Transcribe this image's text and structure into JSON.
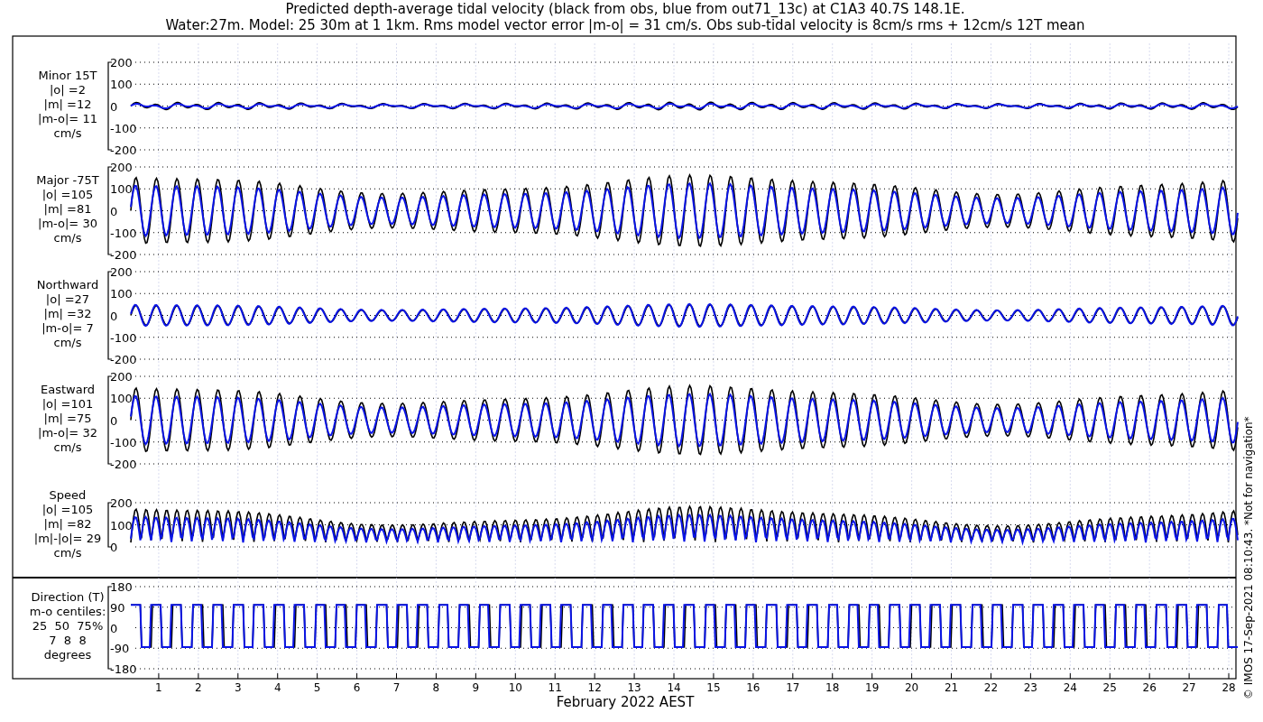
{
  "title_lines": [
    "Predicted depth-average tidal velocity (black from obs, blue from out71_13c) at C1A3 40.7S 148.1E.",
    "Water:27m. Model: 25 30m at 1 1km. Rms model vector error |m-o| = 31 cm/s. Obs sub-tidal velocity is 8cm/s rms + 12cm/s 12T mean"
  ],
  "panels": [
    {
      "kind": "signed",
      "label_lines": [
        "Minor 15T",
        "|o| =2",
        "|m| =12",
        "|m-o|= 11",
        "cm/s"
      ],
      "yticks": [
        "200",
        "100",
        "0",
        "-100",
        "-200"
      ]
    },
    {
      "kind": "signed",
      "label_lines": [
        "Major -75T",
        "|o| =105",
        "|m| =81",
        "|m-o|= 30",
        "cm/s"
      ],
      "yticks": [
        "200",
        "100",
        "0",
        "-100",
        "-200"
      ]
    },
    {
      "kind": "signed",
      "label_lines": [
        "Northward",
        "|o| =27",
        "|m| =32",
        "|m-o|= 7",
        "cm/s"
      ],
      "yticks": [
        "200",
        "100",
        "0",
        "-100",
        "-200"
      ]
    },
    {
      "kind": "signed",
      "label_lines": [
        "Eastward",
        "|o| =101",
        "|m| =75",
        "|m-o|= 32",
        "cm/s"
      ],
      "yticks": [
        "200",
        "100",
        "0",
        "-100",
        "-200"
      ]
    },
    {
      "kind": "speed",
      "label_lines": [
        "Speed",
        "|o| =105",
        "|m| =82",
        "|m|-|o|= 29",
        "cm/s"
      ],
      "yticks": [
        "200",
        "100",
        "0"
      ]
    },
    {
      "kind": "direction",
      "label_lines": [
        "Direction (T)",
        "m-o centiles:",
        "25  50  75%",
        "7  8  8",
        "degrees"
      ],
      "yticks": [
        "180",
        "90",
        "0",
        "-90",
        "-180"
      ]
    }
  ],
  "xticks": [
    "1",
    "2",
    "3",
    "4",
    "5",
    "6",
    "7",
    "8",
    "9",
    "10",
    "11",
    "12",
    "13",
    "14",
    "15",
    "16",
    "17",
    "18",
    "19",
    "20",
    "21",
    "22",
    "23",
    "24",
    "25",
    "26",
    "27",
    "28"
  ],
  "xlabel": "February 2022 AEST",
  "side_note": "© IMOS 17-Sep-2021 08:10:43. *Not for navigation*"
}
